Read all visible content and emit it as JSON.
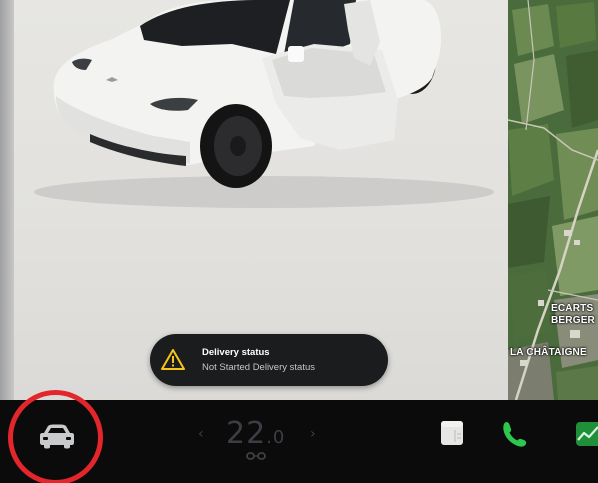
{
  "notification": {
    "icon": "warning-triangle-icon",
    "title": "Delivery status",
    "message": "Not Started Delivery status"
  },
  "map": {
    "labels": {
      "line1": "ECARTS",
      "line2": "BERGER",
      "line3": "LA CHÂTAIGNE"
    }
  },
  "climate": {
    "temperature": "22",
    "temperature_decimal": ".0",
    "down_arrow": "‹",
    "up_arrow": "›"
  },
  "bottom_bar": {
    "icons": [
      "car-icon",
      "seat-heater-icon",
      "notes-app-icon",
      "phone-icon",
      "stocks-app-icon"
    ]
  },
  "colors": {
    "highlight_circle": "#e3262b",
    "phone_green": "#2cc84d",
    "warning_yellow": "#f5c518",
    "bar_background": "#0b0b0c"
  }
}
